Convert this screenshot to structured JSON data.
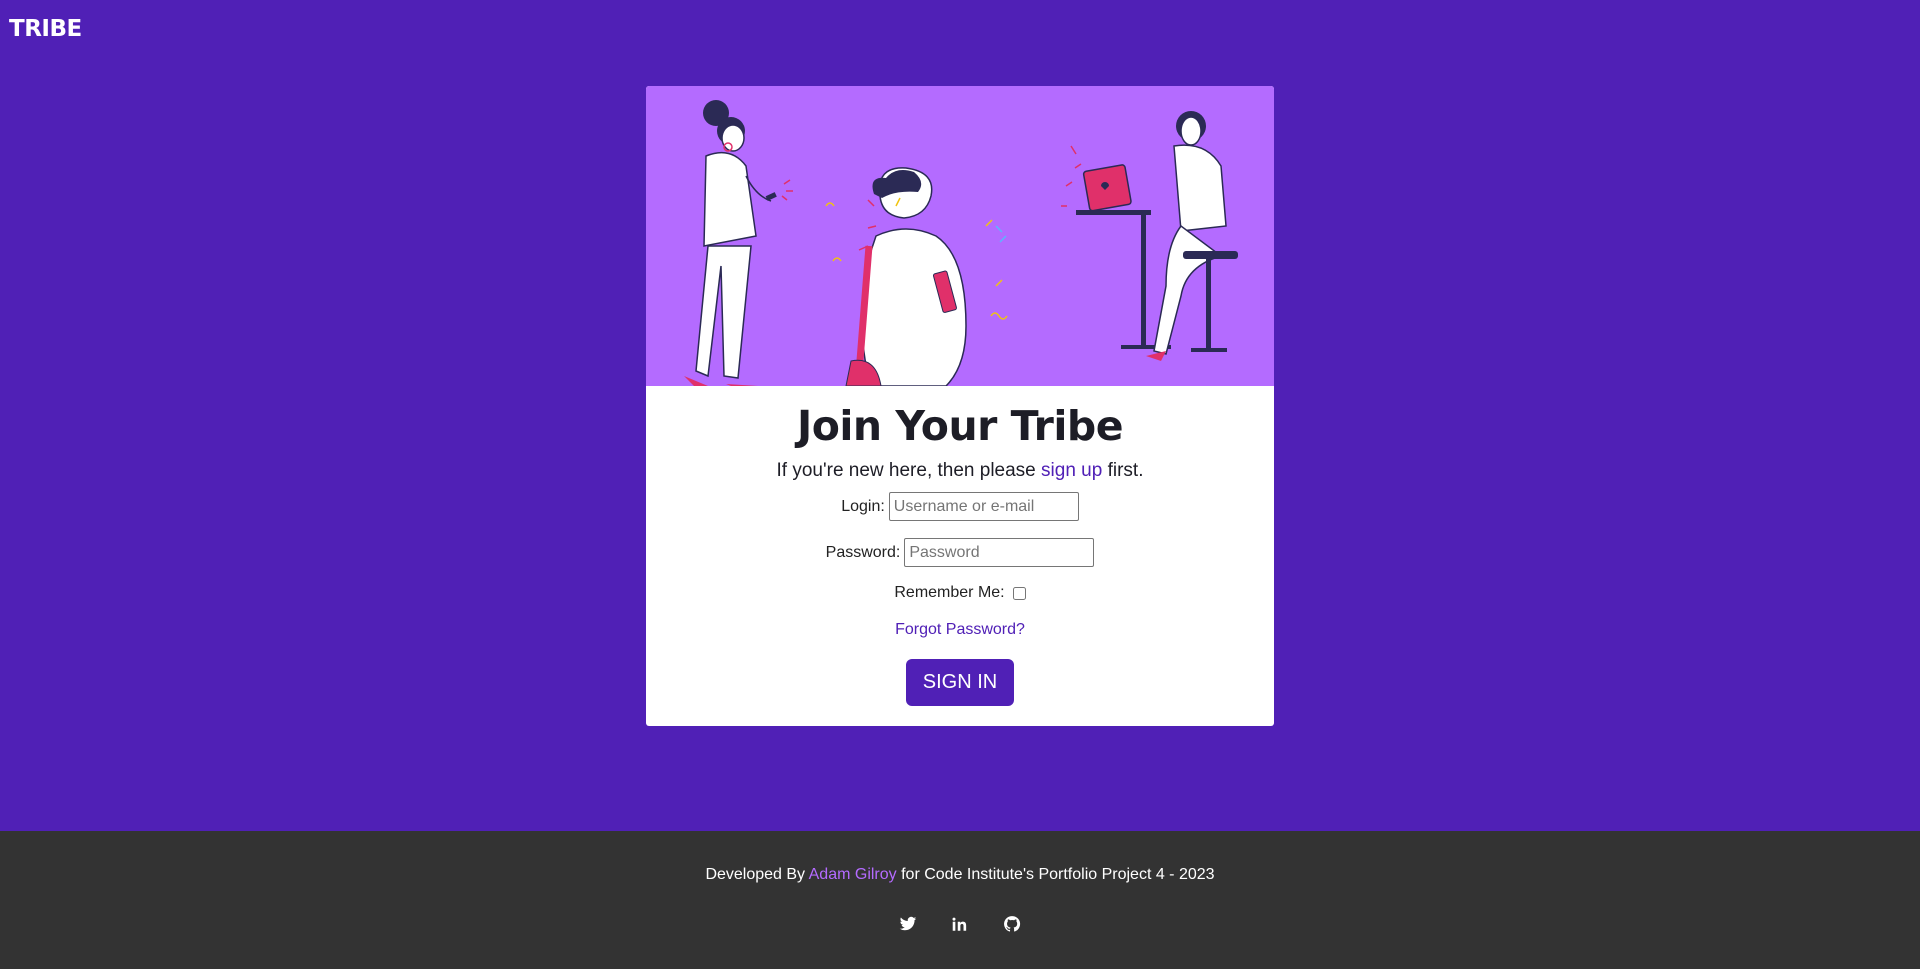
{
  "navbar": {
    "brand": "TRIBE"
  },
  "card": {
    "title": "Join Your Tribe",
    "subtitle_prefix": "If you're new here, then please ",
    "subtitle_link": "sign up",
    "subtitle_suffix": " first.",
    "login_label": "Login:",
    "login_placeholder": "Username or e-mail",
    "password_label": "Password:",
    "password_placeholder": "Password",
    "remember_label": "Remember Me:",
    "remember_checked": false,
    "forgot_link": "Forgot Password?",
    "signin_button": "SIGN IN"
  },
  "footer": {
    "credit_prefix": "Developed By ",
    "credit_name": "Adam Gilroy",
    "credit_suffix": " for Code Institute's Portfolio Project 4 - 2023",
    "socials": [
      "twitter-icon",
      "linkedin-icon",
      "github-icon"
    ]
  },
  "colors": {
    "background": "#5020b6",
    "accent": "#5020b6",
    "hero_bg": "#b46bff",
    "footer_bg": "#333333",
    "link_light": "#b46bff"
  }
}
